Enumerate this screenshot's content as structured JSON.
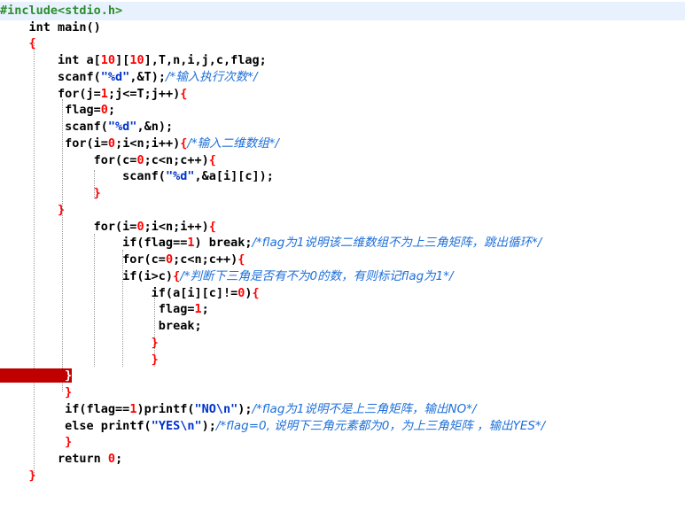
{
  "code_lines": [
    "#include<stdio.h>",
    "    int main()",
    "    {",
    "        int a[10][10],T,n,i,j,c,flag;",
    "        scanf(\"%d\",&T);/*输入执行次数*/",
    "        for(j=1;j<=T;j++){",
    "         flag=0;",
    "         scanf(\"%d\",&n);",
    "         for(i=0;i<n;i++){/*输入二维数组*/",
    "             for(c=0;c<n;c++){",
    "                 scanf(\"%d\",&a[i][c]);",
    "             }",
    "        }",
    "             for(i=0;i<n;i++){",
    "                 if(flag==1) break;/*flag为1说明该二维数组不为上三角矩阵，跳出循环*/",
    "                 for(c=0;c<n;c++){",
    "                 if(i>c){/*判断下三角是否有不为0的数，有则标记flag为1*/",
    "                     if(a[i][c]!=0){",
    "                      flag=1;",
    "                      break;",
    "                     }",
    "                     }",
    "         }",
    "         }",
    "         if(flag==1)printf(\"NO\\n\");/*flag为1说明不是上三角矩阵，输出NO*/",
    "         else printf(\"YES\\n\");/*flag=0, 说明下三角元素都为0，为上三角矩阵 ，输出YES*/",
    "         }",
    "        return 0;",
    "    }"
  ]
}
